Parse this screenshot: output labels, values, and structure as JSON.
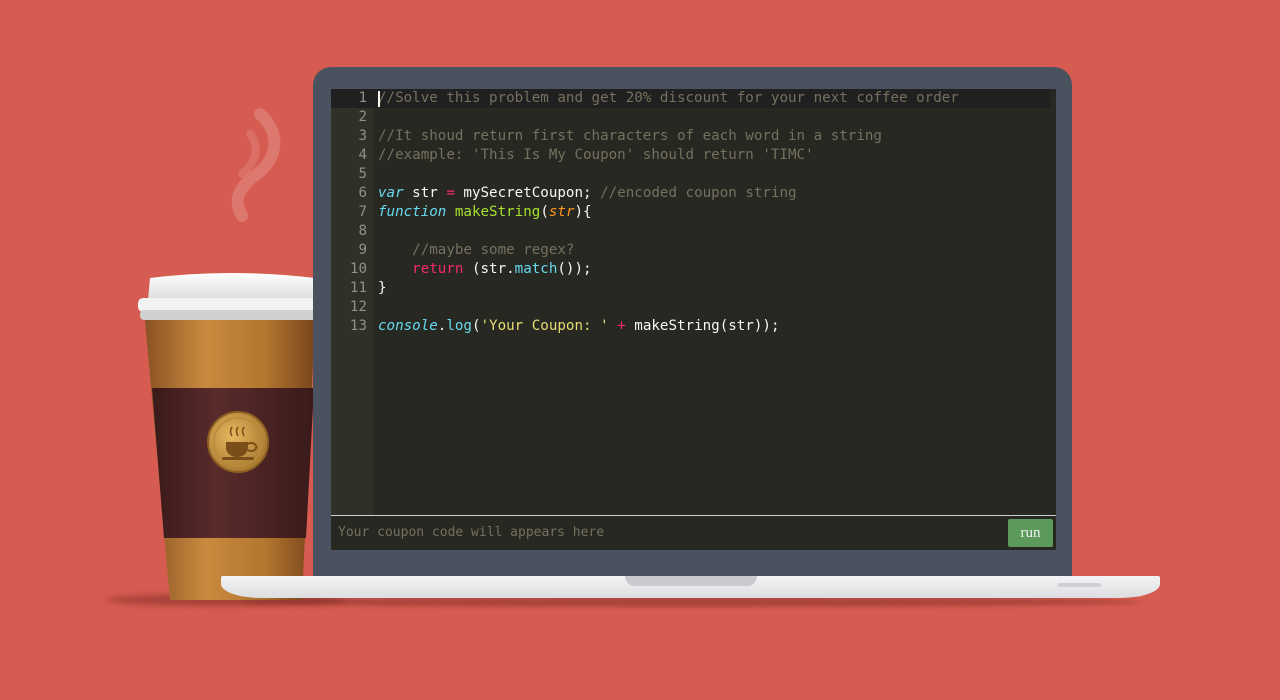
{
  "editor": {
    "lines": [
      {
        "number": "1",
        "parts": [
          {
            "t": "//Solve this problem and get 20% discount for your next coffee order",
            "c": "c-com"
          }
        ]
      },
      {
        "number": "2",
        "parts": []
      },
      {
        "number": "3",
        "parts": [
          {
            "t": "//It shoud return first characters of each word in a string",
            "c": "c-com"
          }
        ]
      },
      {
        "number": "4",
        "parts": [
          {
            "t": "//example: 'This Is My Coupon' should return 'TIMC'",
            "c": "c-com"
          }
        ]
      },
      {
        "number": "5",
        "parts": []
      },
      {
        "number": "6",
        "parts": [
          {
            "t": "var",
            "c": "c-kw-i"
          },
          {
            "t": " str ",
            "c": "c-plain"
          },
          {
            "t": "=",
            "c": "c-op"
          },
          {
            "t": " mySecretCoupon; ",
            "c": "c-plain"
          },
          {
            "t": "//encoded coupon string",
            "c": "c-com"
          }
        ]
      },
      {
        "number": "7",
        "parts": [
          {
            "t": "function",
            "c": "c-kw-i"
          },
          {
            "t": " ",
            "c": "c-plain"
          },
          {
            "t": "makeString",
            "c": "c-fn"
          },
          {
            "t": "(",
            "c": "c-plain"
          },
          {
            "t": "str",
            "c": "c-param"
          },
          {
            "t": "){",
            "c": "c-plain"
          }
        ]
      },
      {
        "number": "8",
        "parts": []
      },
      {
        "number": "9",
        "parts": [
          {
            "t": "    //maybe some regex?",
            "c": "c-com"
          }
        ]
      },
      {
        "number": "10",
        "parts": [
          {
            "t": "    ",
            "c": "c-plain"
          },
          {
            "t": "return",
            "c": "c-kw"
          },
          {
            "t": " (str.",
            "c": "c-plain"
          },
          {
            "t": "match",
            "c": "c-prop"
          },
          {
            "t": "());",
            "c": "c-plain"
          }
        ]
      },
      {
        "number": "11",
        "parts": [
          {
            "t": "}",
            "c": "c-plain"
          }
        ]
      },
      {
        "number": "12",
        "parts": []
      },
      {
        "number": "13",
        "parts": [
          {
            "t": "console",
            "c": "c-sup"
          },
          {
            "t": ".",
            "c": "c-plain"
          },
          {
            "t": "log",
            "c": "c-prop"
          },
          {
            "t": "(",
            "c": "c-plain"
          },
          {
            "t": "'Your Coupon: '",
            "c": "c-str"
          },
          {
            "t": " ",
            "c": "c-plain"
          },
          {
            "t": "+",
            "c": "c-op"
          },
          {
            "t": " makeString(str));",
            "c": "c-plain"
          }
        ]
      }
    ]
  },
  "output": {
    "placeholder": "Your coupon code will appears here",
    "run_label": "run"
  },
  "colors": {
    "background": "#d65b50",
    "editor_bg": "#272822",
    "run_button": "#5b9a5a",
    "laptop_frame": "#4a5260"
  },
  "icons": {
    "cup_badge": "coffee-cup-icon"
  }
}
